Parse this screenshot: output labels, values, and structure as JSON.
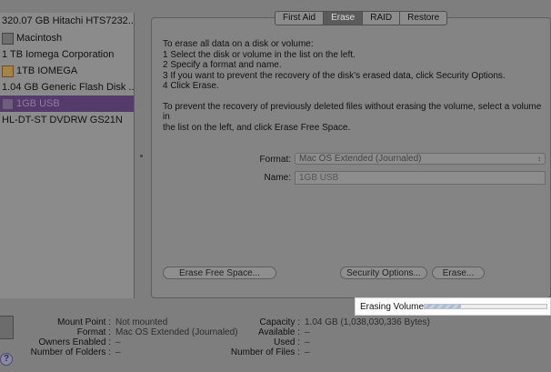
{
  "sidebar": {
    "items": [
      {
        "label": "320.07 GB Hitachi HTS7232...",
        "icon": "none",
        "selected": false
      },
      {
        "label": "Macintosh",
        "icon": "hard-drive-icon",
        "selected": false
      },
      {
        "label": "1 TB Iomega Corporation",
        "icon": "none",
        "selected": false
      },
      {
        "label": "1TB IOMEGA",
        "icon": "external-drive-icon",
        "selected": false
      },
      {
        "label": "1.04 GB Generic Flash Disk ...",
        "icon": "none",
        "selected": false
      },
      {
        "label": "1GB USB",
        "icon": "usb-drive-icon",
        "selected": true
      },
      {
        "label": "HL-DT-ST DVDRW GS21N",
        "icon": "none",
        "selected": false
      }
    ]
  },
  "tabs": [
    {
      "label": "First Aid",
      "active": false
    },
    {
      "label": "Erase",
      "active": true
    },
    {
      "label": "RAID",
      "active": false
    },
    {
      "label": "Restore",
      "active": false
    }
  ],
  "instructions": {
    "line1": "To erase all data on a disk or volume:",
    "line2": "1 Select the disk or volume in the list on the left.",
    "line3": "2 Specify a format and name.",
    "line4": "3 If you want to prevent the recovery of the disk’s erased data, click Security Options.",
    "line5": "4 Click Erase.",
    "line6": "To prevent the recovery of previously deleted files without erasing the volume, select a volume in",
    "line7": "the list on the left, and click Erase Free Space."
  },
  "form": {
    "format_label": "Format:",
    "format_value": "Mac OS Extended (Journaled)",
    "name_label": "Name:",
    "name_value": "1GB USB"
  },
  "buttons": {
    "erase_free_space": "Erase Free Space...",
    "security_options": "Security Options...",
    "erase": "Erase..."
  },
  "erasing": {
    "label": "Erasing Volume",
    "progress_fraction": 0.3
  },
  "info": {
    "left": [
      {
        "label": "Mount Point :",
        "value": "Not mounted"
      },
      {
        "label": "Format :",
        "value": "Mac OS Extended (Journaled)"
      },
      {
        "label": "Owners Enabled :",
        "value": "–"
      },
      {
        "label": "Number of Folders :",
        "value": "–"
      }
    ],
    "right": [
      {
        "label": "Capacity :",
        "value": "1.04 GB (1,038,030,336 Bytes)"
      },
      {
        "label": "Available :",
        "value": "–"
      },
      {
        "label": "Used :",
        "value": "–"
      },
      {
        "label": "Number of Files :",
        "value": "–"
      }
    ]
  },
  "help": {
    "label": "?"
  }
}
